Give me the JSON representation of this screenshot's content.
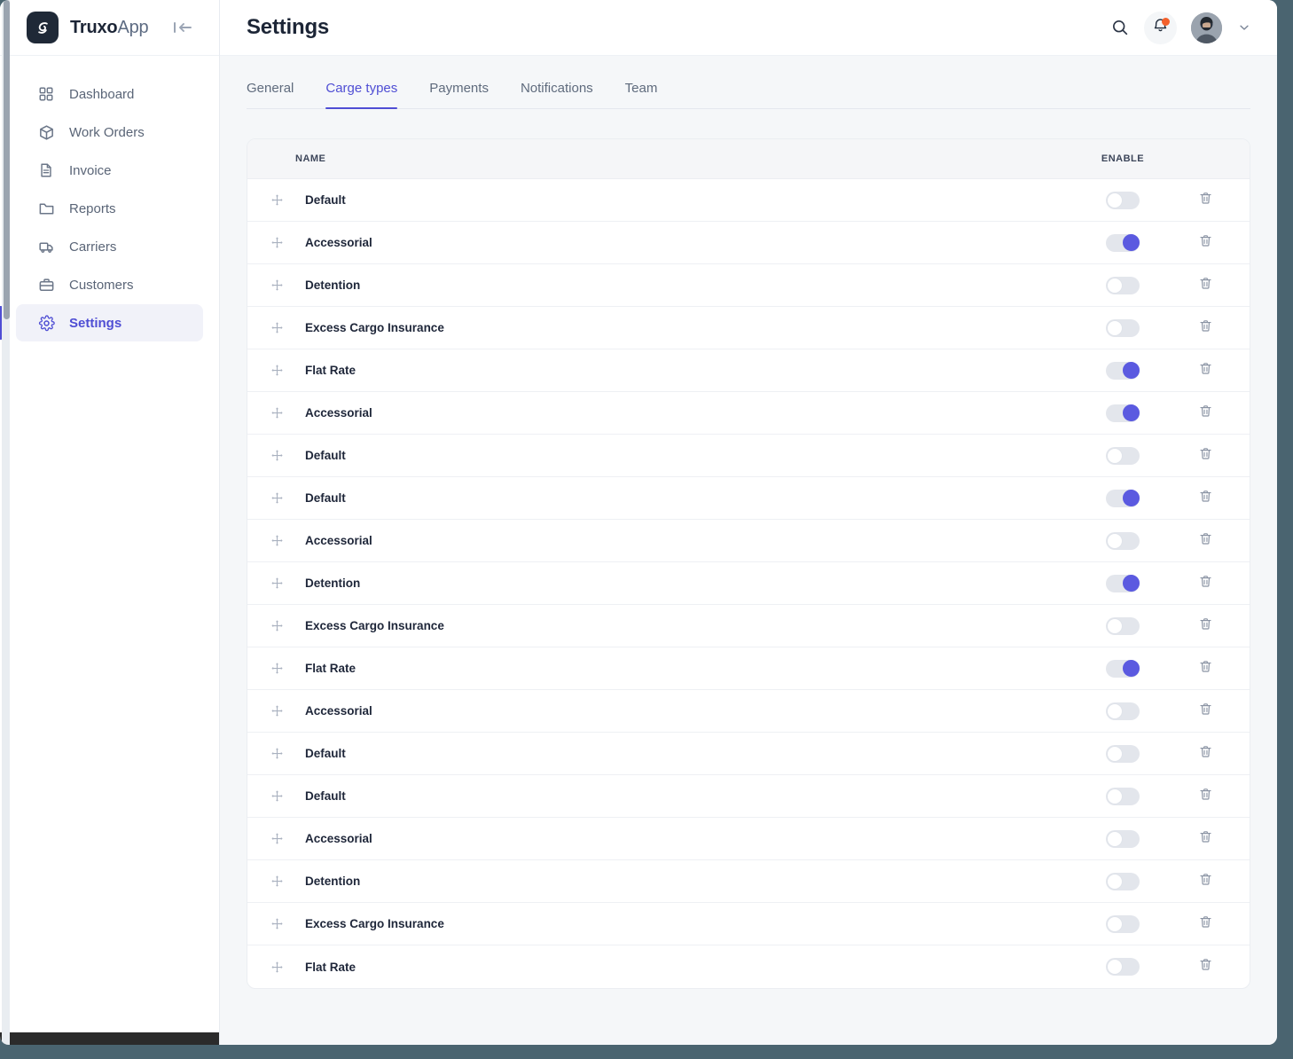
{
  "brand": {
    "name_bold": "Truxo",
    "name_light": "App",
    "logo_icon": "truxo-logo-icon",
    "collapse_icon": "collapse-sidebar-icon"
  },
  "sidebar": {
    "items": [
      {
        "label": "Dashboard",
        "icon": "grid-icon",
        "active": false
      },
      {
        "label": "Work Orders",
        "icon": "box-icon",
        "active": false
      },
      {
        "label": "Invoice",
        "icon": "document-icon",
        "active": false
      },
      {
        "label": "Reports",
        "icon": "folder-icon",
        "active": false
      },
      {
        "label": "Carriers",
        "icon": "truck-icon",
        "active": false
      },
      {
        "label": "Customers",
        "icon": "briefcase-icon",
        "active": false
      },
      {
        "label": "Settings",
        "icon": "gear-icon",
        "active": true
      }
    ]
  },
  "topbar": {
    "title": "Settings",
    "search_icon": "search-icon",
    "bell_icon": "bell-icon",
    "has_notification": true,
    "avatar_icon": "user-avatar",
    "chevron_icon": "chevron-down-icon"
  },
  "tabs": [
    {
      "label": "General",
      "active": false
    },
    {
      "label": "Carge types",
      "active": true
    },
    {
      "label": "Payments",
      "active": false
    },
    {
      "label": "Notifications",
      "active": false
    },
    {
      "label": "Team",
      "active": false
    }
  ],
  "table": {
    "columns": {
      "name": "NAME",
      "enable": "ENABLE"
    },
    "drag_icon": "drag-move-icon",
    "delete_icon": "trash-icon",
    "rows": [
      {
        "name": "Default",
        "enabled": false
      },
      {
        "name": "Accessorial",
        "enabled": true
      },
      {
        "name": "Detention",
        "enabled": false
      },
      {
        "name": "Excess Cargo Insurance",
        "enabled": false
      },
      {
        "name": "Flat Rate",
        "enabled": true
      },
      {
        "name": "Accessorial",
        "enabled": true
      },
      {
        "name": "Default",
        "enabled": false
      },
      {
        "name": "Default",
        "enabled": true
      },
      {
        "name": "Accessorial",
        "enabled": false
      },
      {
        "name": "Detention",
        "enabled": true
      },
      {
        "name": "Excess Cargo Insurance",
        "enabled": false
      },
      {
        "name": "Flat Rate",
        "enabled": true
      },
      {
        "name": "Accessorial",
        "enabled": false
      },
      {
        "name": "Default",
        "enabled": false
      },
      {
        "name": "Default",
        "enabled": false
      },
      {
        "name": "Accessorial",
        "enabled": false
      },
      {
        "name": "Detention",
        "enabled": false
      },
      {
        "name": "Excess Cargo Insurance",
        "enabled": false
      },
      {
        "name": "Flat Rate",
        "enabled": false
      }
    ]
  },
  "colors": {
    "accent": "#4f4ed4",
    "toggle_on": "#5b5ae0",
    "notification_dot": "#f4612c",
    "page_bg": "#f5f7f9",
    "outer_bg": "#4a6470"
  }
}
